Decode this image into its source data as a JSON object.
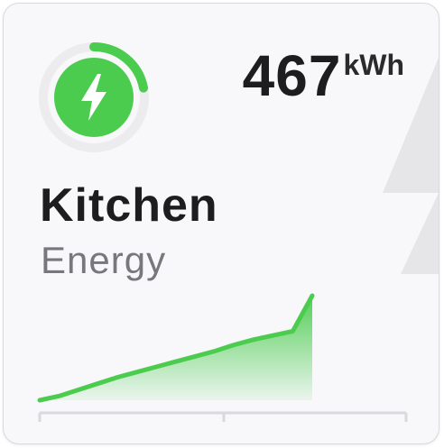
{
  "card": {
    "title": "Kitchen",
    "subtitle": "Energy",
    "value": "467",
    "unit": "kWh",
    "icon": "lightning-bolt-icon",
    "accent_color": "#4ccc4f",
    "ring_progress": 0.22
  },
  "chart_data": {
    "type": "area",
    "x": [
      0,
      1,
      2,
      3,
      4,
      5,
      6,
      7,
      8,
      9,
      10,
      11,
      12,
      13,
      14
    ],
    "values": [
      0,
      4,
      10,
      16,
      22,
      27,
      32,
      37,
      42,
      47,
      53,
      58,
      62,
      66,
      100
    ],
    "title": "",
    "xlabel": "",
    "ylabel": "",
    "grid": false,
    "color": "#4ccc4f"
  }
}
